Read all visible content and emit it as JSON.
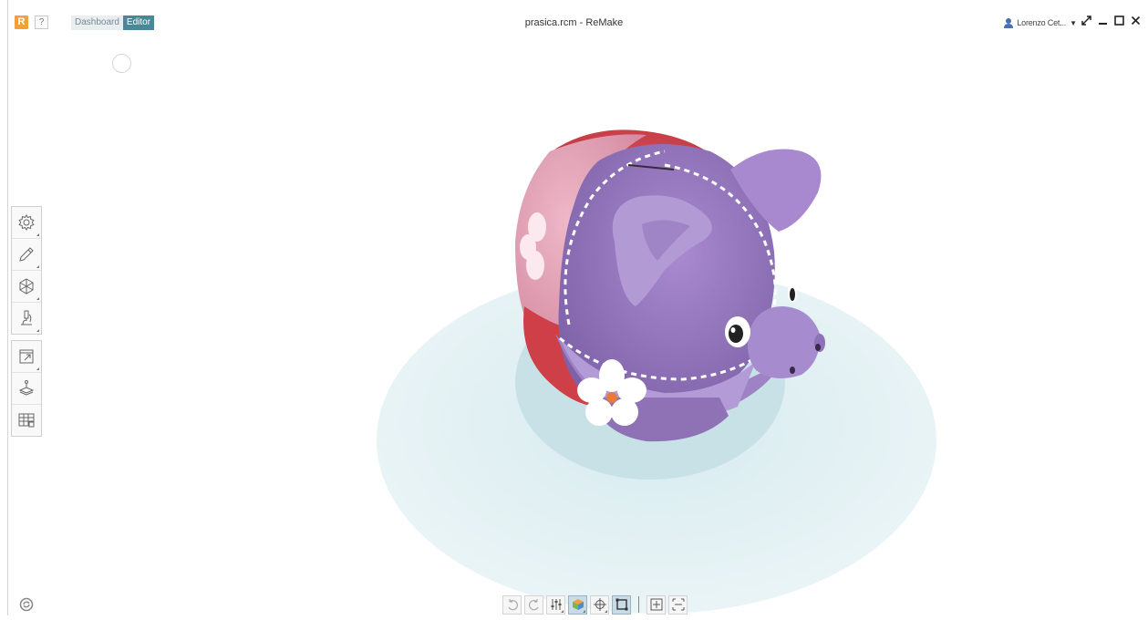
{
  "titlebar": {
    "logo": "R",
    "help": "?",
    "tabs": [
      {
        "label": "Dashboard",
        "active": false
      },
      {
        "label": "Editor",
        "active": true
      }
    ],
    "window_title": "prasica.rcm - ReMake",
    "user_name": "Lorenzo Cet...",
    "user_caret": "▼"
  },
  "left_toolbar": {
    "group1": [
      "gear-icon",
      "pencil-icon",
      "mesh-icon",
      "microscope-icon"
    ],
    "group2": [
      "export-icon",
      "print-3d-icon",
      "table-icon"
    ]
  },
  "bottom_toolbar": {
    "buttons": [
      "undo-icon",
      "redo-icon",
      "sliders-icon",
      "shaded-cube-icon",
      "pivot-icon",
      "bounding-box-icon",
      "fit-icon",
      "frame-icon"
    ],
    "active": [
      "shaded-cube-icon",
      "bounding-box-icon"
    ]
  },
  "colors": {
    "accent": "#4a8898",
    "logo": "#f2a13a",
    "ground_outer": "#e4f1f4",
    "ground_inner": "#c9e2e8",
    "pig_purple": "#9a7cc0",
    "pig_red": "#d9464a",
    "pig_pink": "#e6a3b8"
  }
}
